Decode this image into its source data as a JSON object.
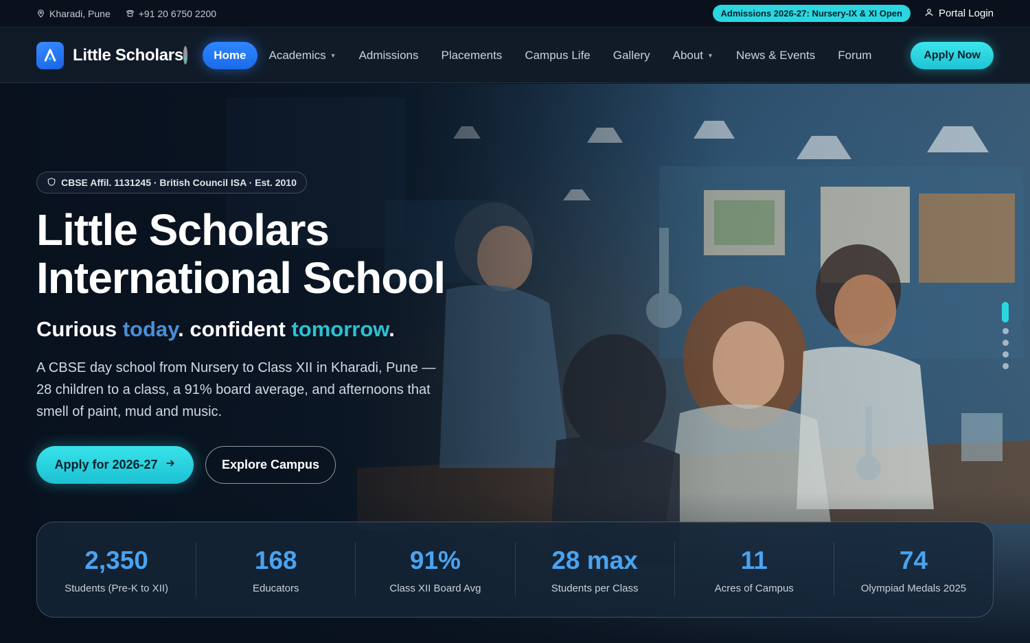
{
  "topbar": {
    "location": "Kharadi, Pune",
    "phone": "+91 20 6750 2200",
    "admissions_pill": "Admissions 2026-27: Nursery-IX & XI Open",
    "portal_login": "Portal Login"
  },
  "nav": {
    "brand": "Little Scholars",
    "brand_dot": ".",
    "items": [
      {
        "label": "Home",
        "active": true
      },
      {
        "label": "Academics",
        "dropdown": true
      },
      {
        "label": "Admissions"
      },
      {
        "label": "Placements"
      },
      {
        "label": "Campus Life"
      },
      {
        "label": "Gallery"
      },
      {
        "label": "About",
        "dropdown": true
      },
      {
        "label": "News & Events"
      },
      {
        "label": "Forum"
      }
    ],
    "cta": "Apply Now"
  },
  "hero": {
    "affiliation": "CBSE Affil. 1131245 · British Council ISA · Est. 2010",
    "title_line1": "Little Scholars",
    "title_line2": "International School",
    "tagline_part1": "Curious ",
    "tagline_accent1": "today",
    "tagline_part2": ". confident ",
    "tagline_accent2": "tomorrow",
    "tagline_part3": ".",
    "description": "A CBSE day school from Nursery to Class XII in Kharadi, Pune — 28 children to a class, a 91% board average, and afternoons that smell of paint, mud and music.",
    "primary_button": "Apply for 2026-27",
    "secondary_button": "Explore Campus",
    "slide_count": 5,
    "active_slide": 1
  },
  "stats": [
    {
      "value": "2,350",
      "label": "Students (Pre-K to XII)"
    },
    {
      "value": "168",
      "label": "Educators"
    },
    {
      "value": "91%",
      "label": "Class XII Board Avg"
    },
    {
      "value": "28 max",
      "label": "Students per Class"
    },
    {
      "value": "11",
      "label": "Acres of Campus"
    },
    {
      "value": "74",
      "label": "Olympiad Medals 2025"
    }
  ],
  "colors": {
    "accent_cyan": "#2ad7e0",
    "accent_blue": "#2f86ff",
    "stat_value": "#4aa3f0",
    "background": "#0b1522"
  },
  "icons": {
    "location": "map-pin-icon",
    "phone": "phone-icon",
    "portal": "user-icon",
    "logo": "logo-a-icon",
    "shield": "shield-icon",
    "arrow": "arrow-right-icon",
    "caret": "chevron-down-icon"
  }
}
